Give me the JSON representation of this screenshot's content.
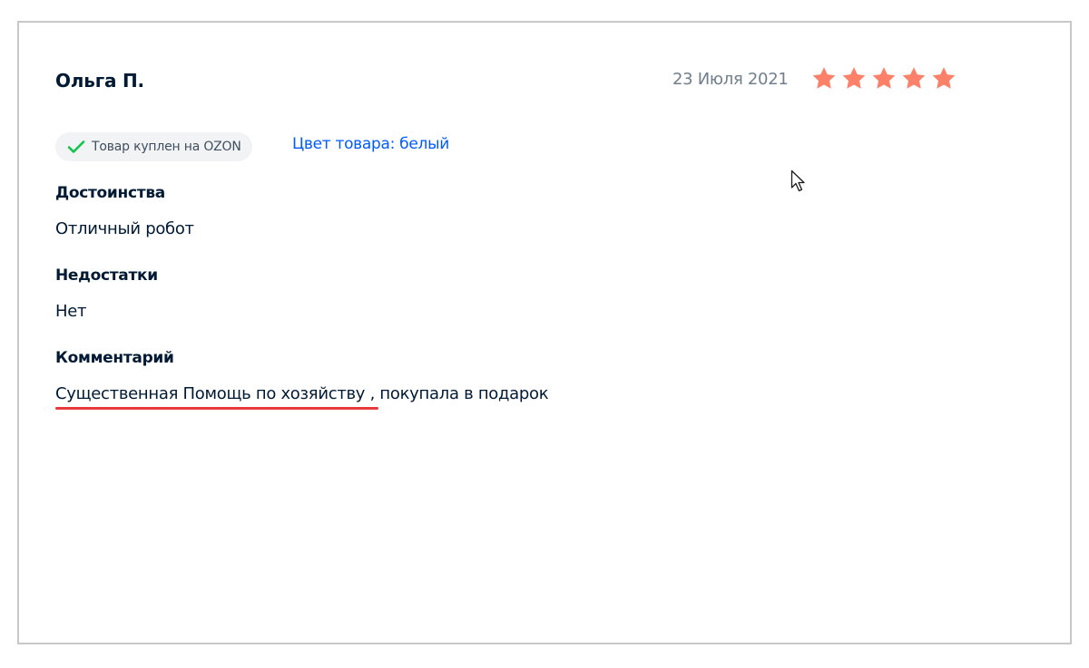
{
  "review": {
    "author": "Ольга П.",
    "date": "23 Июля 2021",
    "rating": 5,
    "rating_max": 5,
    "star_color": "#fd8069",
    "badge": {
      "icon": "check-icon",
      "text": "Товар куплен на OZON",
      "check_color": "#10c44c"
    },
    "product_color": "Цвет товара: белый",
    "sections": {
      "pros": {
        "title": "Достоинства",
        "text": "Отличный робот"
      },
      "cons": {
        "title": "Недостатки",
        "text": "Нет"
      },
      "comment": {
        "title": "Комментарий",
        "text": "Существенная Помощь по хозяйству , покупала в подарок"
      }
    },
    "highlight_color": "#e8393f"
  }
}
